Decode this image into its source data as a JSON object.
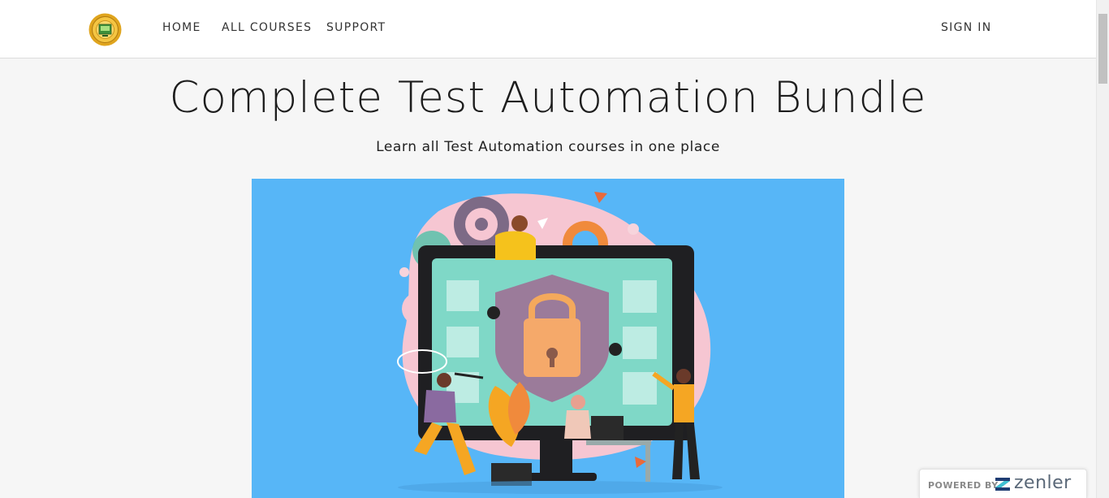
{
  "header": {
    "logo_icon": "academy-seal-logo",
    "nav": {
      "home": "HOME",
      "all_courses": "ALL COURSES",
      "support": "SUPPORT"
    },
    "sign_in": "SIGN IN"
  },
  "hero": {
    "title": "Complete Test Automation Bundle",
    "subtitle": "Learn all Test Automation courses in one place",
    "image": "security-automation-illustration"
  },
  "badge": {
    "powered_by": "POWERED BY",
    "brand": "zenler"
  },
  "colors": {
    "hero_bg": "#57b6f7",
    "header_bg": "#ffffff",
    "page_bg": "#f6f6f6",
    "accent_orange": "#f5a623"
  }
}
